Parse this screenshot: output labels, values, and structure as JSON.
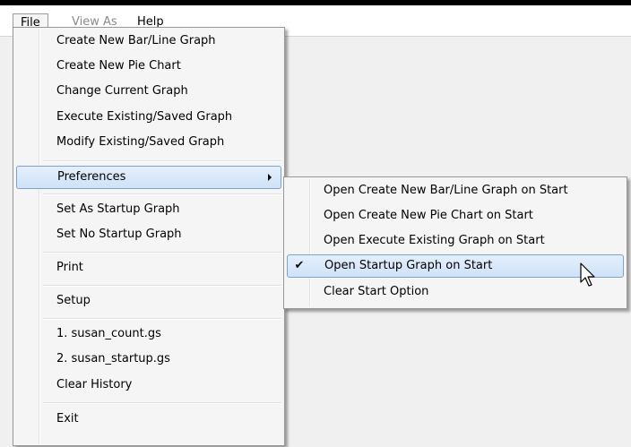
{
  "menubar": {
    "items": [
      {
        "label": "File"
      },
      {
        "label": "View As"
      },
      {
        "label": "Help"
      }
    ]
  },
  "file_menu": {
    "items": [
      "Create New Bar/Line Graph",
      "Create New Pie Chart",
      "Change Current Graph",
      "Execute Existing/Saved Graph",
      "Modify Existing/Saved Graph",
      "Preferences",
      "Set As Startup Graph",
      "Set No Startup Graph",
      "Print",
      "Setup",
      "1. susan_count.gs",
      "2. susan_startup.gs",
      "Clear History",
      "Exit"
    ]
  },
  "preferences_menu": {
    "items": [
      {
        "label": "Open Create New Bar/Line Graph on Start",
        "checked": false
      },
      {
        "label": "Open Create New Pie Chart on Start",
        "checked": false
      },
      {
        "label": "Open Execute Existing Graph on Start",
        "checked": false
      },
      {
        "label": "Open Startup Graph on Start",
        "checked": true
      },
      {
        "label": "Clear Start Option",
        "checked": false
      }
    ],
    "check_glyph": "✔"
  },
  "icons": {
    "submenu_arrow": "chevron-right-icon",
    "check": "checkmark-icon",
    "cursor": "mouse-pointer-icon"
  },
  "colors": {
    "highlight_border": "#7da2ce",
    "highlight_fill": "#cfe2f8",
    "menu_background": "#f5f5f5",
    "disabled_text": "#8a8a8a"
  }
}
